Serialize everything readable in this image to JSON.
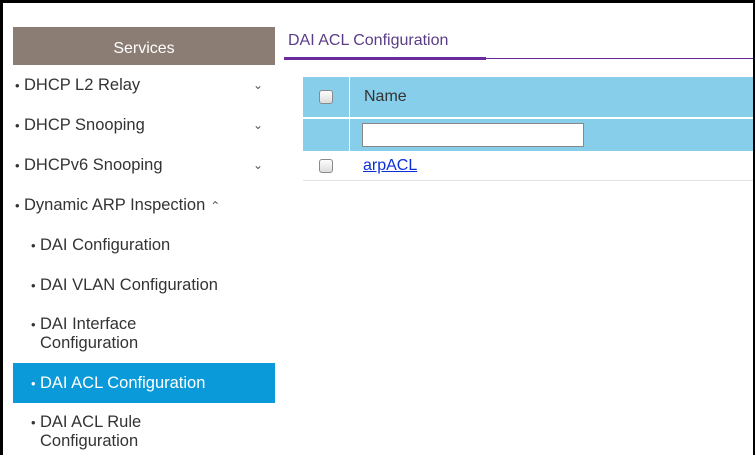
{
  "sidebar": {
    "header": "Services",
    "items": [
      {
        "bullet": "•",
        "label": "DHCP L2 Relay",
        "chevron": "⌄"
      },
      {
        "bullet": "•",
        "label": "DHCP Snooping",
        "chevron": "⌄"
      },
      {
        "bullet": "•",
        "label": "DHCPv6 Snooping",
        "chevron": "⌄"
      },
      {
        "bullet": "•",
        "label": "Dynamic ARP Inspection",
        "chevron": "⌃"
      }
    ],
    "subitems": [
      {
        "bullet": "•",
        "label": "DAI Configuration"
      },
      {
        "bullet": "•",
        "label": "DAI VLAN Configuration"
      },
      {
        "bullet": "•",
        "line1": "DAI Interface",
        "line2": "Configuration"
      },
      {
        "bullet": "•",
        "label": "DAI ACL Configuration",
        "active": true
      },
      {
        "bullet": "•",
        "line1": "DAI ACL Rule",
        "line2": "Configuration"
      }
    ]
  },
  "main": {
    "title": "DAI ACL Configuration",
    "table": {
      "columns": [
        "Name"
      ],
      "filter_value": "",
      "rows": [
        {
          "name": "arpACL"
        }
      ]
    }
  },
  "colors": {
    "sidebar_header": "#8c7d74",
    "active_item": "#0a9ad9",
    "table_header": "#87ceeb",
    "title_rule": "#6a2c9c",
    "link": "#0a2fd9"
  }
}
